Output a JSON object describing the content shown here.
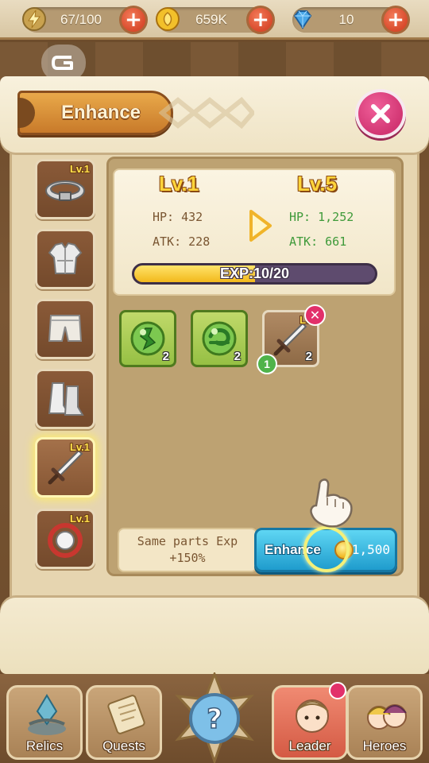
{
  "resources": {
    "energy": {
      "value": "67/100",
      "icon": "lightning-icon"
    },
    "gold": {
      "value": "659K",
      "icon": "coin-icon"
    },
    "gems": {
      "value": "10",
      "icon": "gem-icon"
    }
  },
  "panel": {
    "title": "Enhance"
  },
  "equipment_slots": [
    {
      "name": "belt",
      "level": "Lv.1"
    },
    {
      "name": "armor",
      "level": ""
    },
    {
      "name": "pants",
      "level": ""
    },
    {
      "name": "boots",
      "level": ""
    },
    {
      "name": "sword",
      "level": "Lv.1",
      "selected": true
    },
    {
      "name": "ring",
      "level": "Lv.1"
    }
  ],
  "stats": {
    "current_level": "Lv.1",
    "next_level": "Lv.5",
    "current_hp": "HP: 432",
    "current_atk": "ATK: 228",
    "next_hp": "HP: 1,252",
    "next_atk": "ATK: 661",
    "exp_text": "EXP:10/20",
    "exp_fraction": 0.5
  },
  "materials": [
    {
      "type": "green-potion",
      "count": "2"
    },
    {
      "type": "green-swirl-orb",
      "count": "2"
    },
    {
      "type": "sword",
      "count": "2",
      "level": "Lv.",
      "selected_index": "1"
    }
  ],
  "bonus": {
    "line1": "Same parts Exp",
    "line2": "+150%"
  },
  "enhance_button": {
    "label": "Enhance",
    "cost": "1,500"
  },
  "nav": {
    "relics": "Relics",
    "quests": "Quests",
    "leader": "Leader",
    "heroes": "Heroes"
  },
  "colors": {
    "accent_gold": "#ffd43a",
    "next_stat_green": "#3f9a3a",
    "enhance_blue": "#1f9ccd",
    "close_pink": "#d23673"
  }
}
